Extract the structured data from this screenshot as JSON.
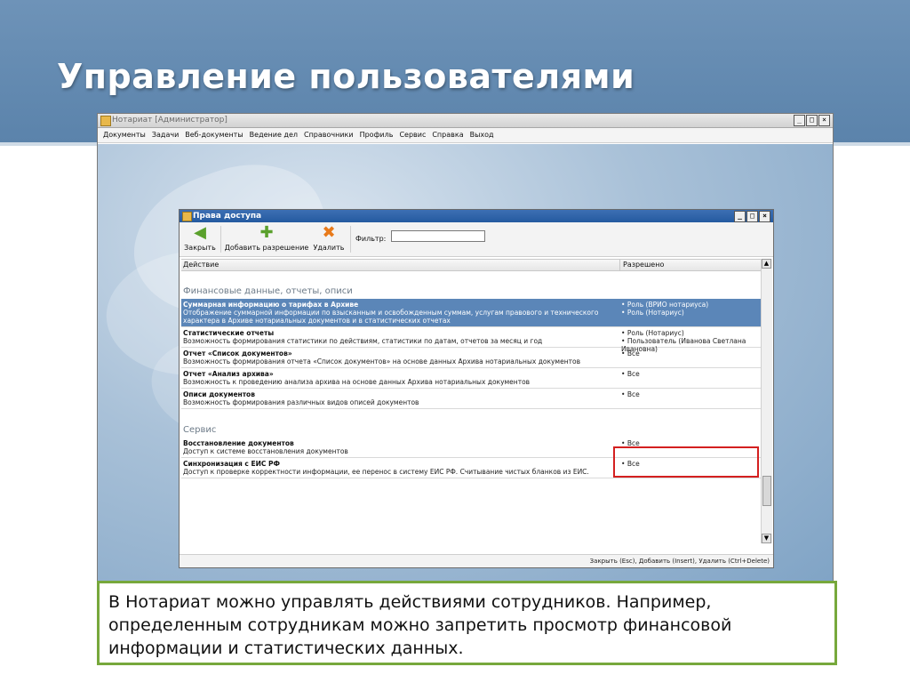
{
  "slide": {
    "title": "Управление пользователями",
    "caption": "В Нотариат можно управлять действиями сотрудников. Например, определенным сотрудникам можно запретить просмотр финансовой информации и статистических данных."
  },
  "main_window": {
    "title": "Нотариат [Администратор]",
    "menu": [
      "Документы",
      "Задачи",
      "Веб-документы",
      "Ведение дел",
      "Справочники",
      "Профиль",
      "Сервис",
      "Справка",
      "Выход"
    ]
  },
  "dialog": {
    "title": "Права доступа",
    "toolbar": {
      "close_label": "Закрыть",
      "add_label": "Добавить разрешение",
      "delete_label": "Удалить",
      "filter_label": "Фильтр:",
      "filter_value": ""
    },
    "columns": {
      "action": "Действие",
      "allowed": "Разрешено"
    },
    "sections": [
      {
        "title": "Финансовые данные, отчеты, описи",
        "rows": [
          {
            "title": "Суммарная информацию о тарифах в Архиве",
            "desc": "Отображение суммарной информации по взысканным и освобожденным суммам, услугам правового и технического характера в Архиве нотариальных документов и в статистических отчетах",
            "allowed": [
              "Роль (ВРИО нотариуса)",
              "Роль (Нотариус)"
            ],
            "selected": true
          },
          {
            "title": "Статистические отчеты",
            "desc": "Возможность формирования статистики по действиям, статистики по датам, отчетов за месяц и год",
            "allowed": [
              "Роль (Нотариус)",
              "Пользователь (Иванова Светлана Ивановна)"
            ],
            "selected": false
          },
          {
            "title": "Отчет «Список документов»",
            "desc": "Возможность формирования отчета «Список документов» на основе данных Архива нотариальных документов",
            "allowed": [
              "Все"
            ],
            "selected": false
          },
          {
            "title": "Отчет «Анализ архива»",
            "desc": "Возможность к проведению анализа архива на основе данных Архива нотариальных документов",
            "allowed": [
              "Все"
            ],
            "selected": false
          },
          {
            "title": "Описи документов",
            "desc": "Возможность формирования различных видов описей документов",
            "allowed": [
              "Все"
            ],
            "selected": false
          }
        ]
      },
      {
        "title": "Сервис",
        "rows": [
          {
            "title": "Восстановление документов",
            "desc": "Доступ к системе восстановления документов",
            "allowed": [
              "Все"
            ],
            "selected": false
          },
          {
            "title": "Синхронизация с ЕИС РФ",
            "desc": "Доступ к проверке корректности информации, ее перенос в систему ЕИС РФ. Считывание чистых бланков из ЕИС.",
            "allowed": [
              "Все"
            ],
            "selected": false
          }
        ]
      }
    ],
    "status": "Закрыть (Esc), Добавить (Insert), Удалить (Ctrl+Delete)"
  },
  "colors": {
    "header_blue": "#5b83ab",
    "selected_row": "#5b86b8",
    "highlight_red": "#d42020",
    "caption_border": "#77a83c"
  },
  "icons": {
    "close": "green-left-arrow-icon",
    "add": "green-plus-icon",
    "delete": "orange-x-icon"
  }
}
